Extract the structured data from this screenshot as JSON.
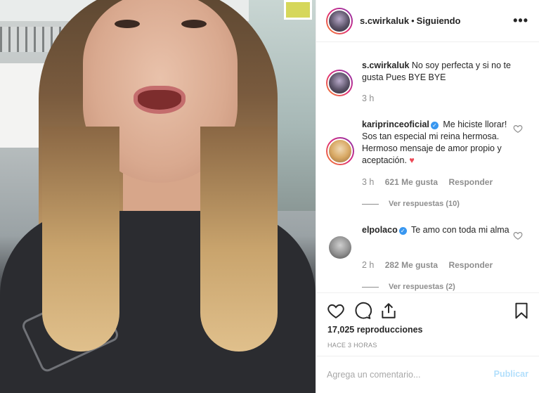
{
  "post": {
    "username": "s.cwirkaluk",
    "separator": "•",
    "following_label": "Siguiendo",
    "more_label": "•••"
  },
  "caption": {
    "username": "s.cwirkaluk",
    "text": "No soy perfecta y si no te gusta Pues BYE BYE",
    "time": "3 h"
  },
  "comments": [
    {
      "username": "kariprinceoficial",
      "verified": true,
      "text": "Me hiciste llorar! Sos tan especial mi reina hermosa. Hermoso mensaje de amor propio y aceptación.",
      "emoji": "♥",
      "time": "3 h",
      "likes": "621 Me gusta",
      "reply_label": "Responder",
      "view_replies": "Ver respuestas (10)"
    },
    {
      "username": "elpolaco",
      "verified": true,
      "text": "Te amo con toda mi alma",
      "time": "2 h",
      "likes": "282 Me gusta",
      "reply_label": "Responder",
      "view_replies": "Ver respuestas (2)"
    }
  ],
  "actions": {
    "icons": [
      "heart-icon",
      "comment-icon",
      "share-icon",
      "bookmark-icon"
    ],
    "views_count": "17,025",
    "views_label": "reproducciones",
    "posted_ago": "HACE 3 HORAS"
  },
  "add_comment": {
    "placeholder": "Agrega un comentario...",
    "post_label": "Publicar"
  },
  "colors": {
    "verified": "#3897f0",
    "post_disabled": "#b2dffc",
    "muted_text": "#8e8e8e",
    "heart_emoji": "#ed4956"
  }
}
